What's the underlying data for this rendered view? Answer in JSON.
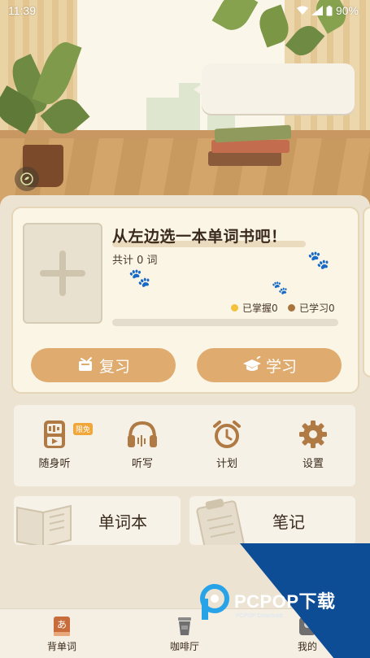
{
  "status_bar": {
    "time": "11:39",
    "battery": "90%"
  },
  "book_card": {
    "title": "从左边选一本单词书吧！",
    "word_count": "共计 0 词",
    "mastered_label": "已掌握0",
    "learned_label": "已学习0",
    "progress_fraction": 0,
    "review_button": "复习",
    "study_button": "学习"
  },
  "tools": [
    {
      "label": "随身听",
      "badge": "限免",
      "icon": "mp3-player-icon"
    },
    {
      "label": "听写",
      "icon": "headphones-icon"
    },
    {
      "label": "计划",
      "icon": "alarm-clock-icon"
    },
    {
      "label": "设置",
      "icon": "gear-icon"
    }
  ],
  "cards": {
    "wordbook": "单词本",
    "notes": "笔记"
  },
  "bottom_nav": [
    {
      "label": "背单词",
      "icon": "kana-book-icon",
      "active": true
    },
    {
      "label": "咖啡厅",
      "icon": "coffee-cup-icon",
      "active": false
    },
    {
      "label": "我的",
      "icon": "profile-icon",
      "active": false
    }
  ],
  "watermark": {
    "brand": "PCPOP下载",
    "sub": "PCPOP Download"
  },
  "colors": {
    "accent": "#dfab6e",
    "icon_brown": "#b07a45",
    "mastered_dot": "#f3c13a",
    "learned_dot": "#a8743c",
    "watermark_blue": "#0c4d96"
  }
}
